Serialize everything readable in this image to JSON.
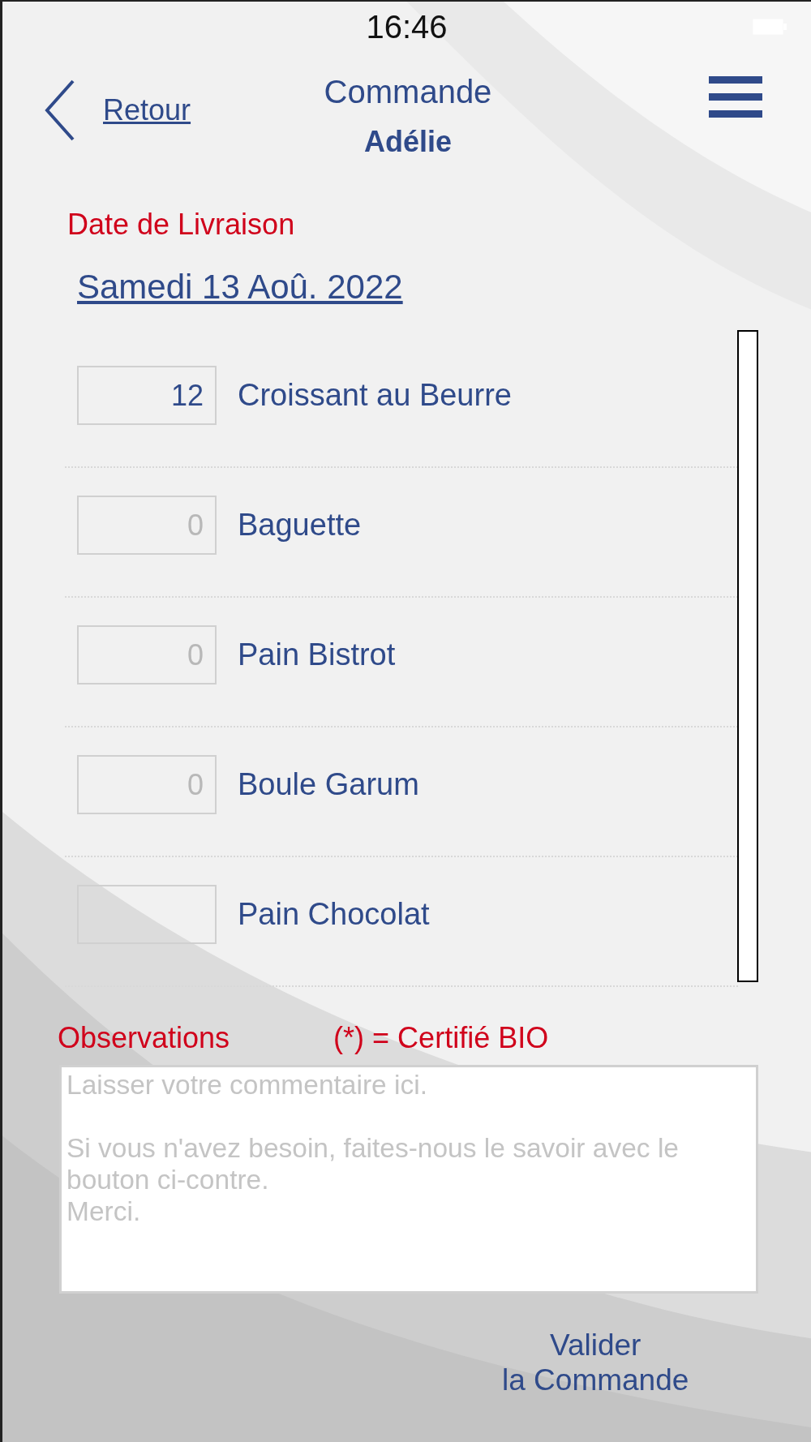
{
  "status_bar": {
    "time": "16:46"
  },
  "header": {
    "back_label": "Retour",
    "title": "Commande",
    "subtitle": "Adélie"
  },
  "delivery": {
    "label": "Date de Livraison",
    "date": "Samedi 13 Aoû. 2022"
  },
  "products": [
    {
      "quantity": "12",
      "name": "Croissant au Beurre"
    },
    {
      "placeholder": "0",
      "name": "Baguette"
    },
    {
      "placeholder": "0",
      "name": "Pain Bistrot"
    },
    {
      "placeholder": "0",
      "name": "Boule Garum"
    },
    {
      "name": "Pain Chocolat"
    }
  ],
  "observations": {
    "label": "Observations",
    "legend": "(*) = Certifié BIO",
    "placeholder": "Laisser votre commentaire ici.\n\nSi vous n'avez besoin, faites-nous le savoir avec le bouton ci-contre.\nMerci."
  },
  "submit_button": "Valider\nla Commande"
}
